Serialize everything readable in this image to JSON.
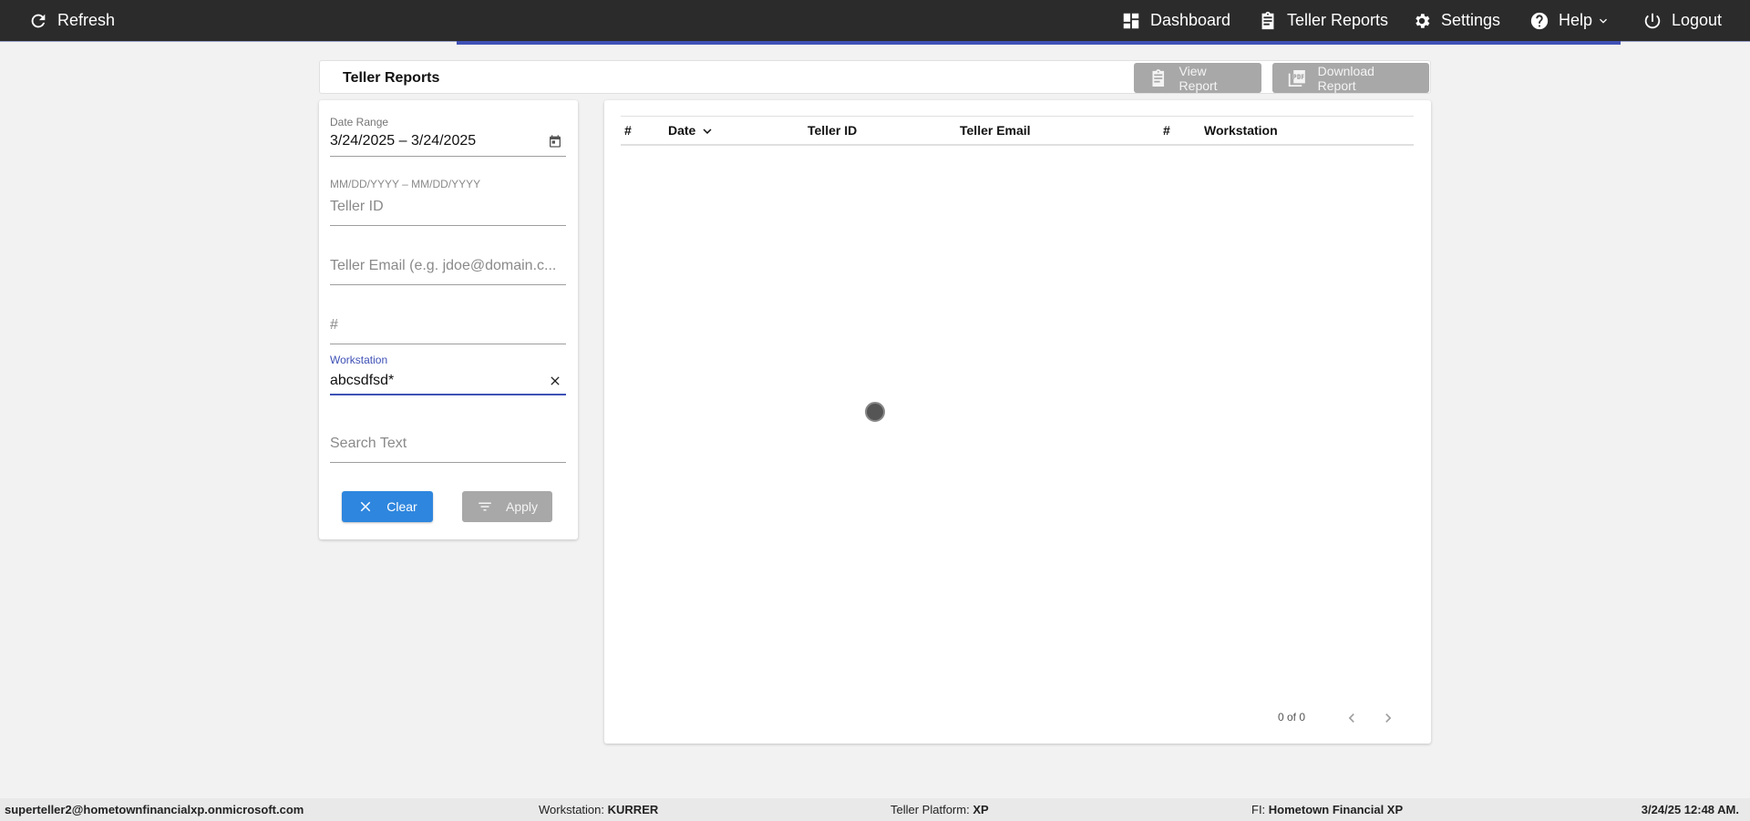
{
  "topbar": {
    "refresh_label": "Refresh",
    "dashboard_label": "Dashboard",
    "teller_reports_label": "Teller Reports",
    "settings_label": "Settings",
    "help_label": "Help",
    "logout_label": "Logout"
  },
  "report_header": {
    "title": "Teller Reports",
    "view_report_label": "View Report",
    "download_report_label": "Download Report"
  },
  "filters": {
    "date_range_label": "Date Range",
    "date_range_value": "3/24/2025 – 3/24/2025",
    "date_range_hint": "MM/DD/YYYY – MM/DD/YYYY",
    "teller_id_placeholder": "Teller ID",
    "teller_email_placeholder": "Teller Email (e.g. jdoe@domain.c...",
    "number_placeholder": "#",
    "workstation_label": "Workstation",
    "workstation_value": "abcsdfsd*",
    "search_text_placeholder": "Search Text",
    "clear_label": "Clear",
    "apply_label": "Apply"
  },
  "table": {
    "columns": [
      "#",
      "Date",
      "Teller ID",
      "Teller Email",
      "#",
      "Workstation"
    ],
    "rows": []
  },
  "pager": {
    "text": "0 of 0"
  },
  "footer": {
    "user_email": "superteller2@hometownfinancialxp.onmicrosoft.com",
    "workstation_label": "Workstation:",
    "workstation_value": "KURRER",
    "platform_label": "Teller Platform:",
    "platform_value": "XP",
    "fi_label": "FI:",
    "fi_value": "Hometown Financial XP",
    "datetime": "3/24/25 12:48 AM."
  },
  "colors": {
    "topbar_bg": "#2b2b2b",
    "accent": "#3f51b5",
    "primary_button": "#2e86de",
    "disabled_button": "#a8a8a8"
  }
}
